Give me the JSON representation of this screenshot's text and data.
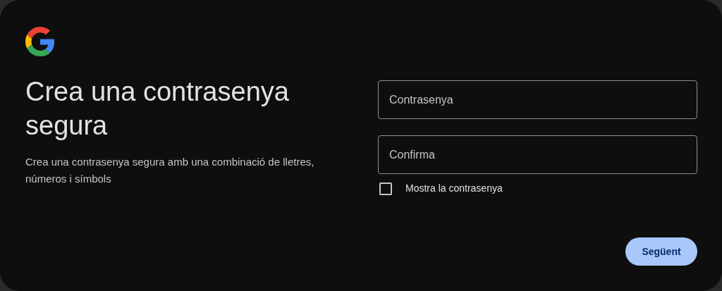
{
  "heading": "Crea una contrasenya segura",
  "description": "Crea una contrasenya segura amb una combinació de lletres, números i símbols",
  "fields": [
    {
      "placeholder": "Contrasenya"
    },
    {
      "placeholder": "Confirma"
    }
  ],
  "show_password": {
    "label": "Mostra la contrasenya",
    "checked": false
  },
  "next_button": "Següent"
}
